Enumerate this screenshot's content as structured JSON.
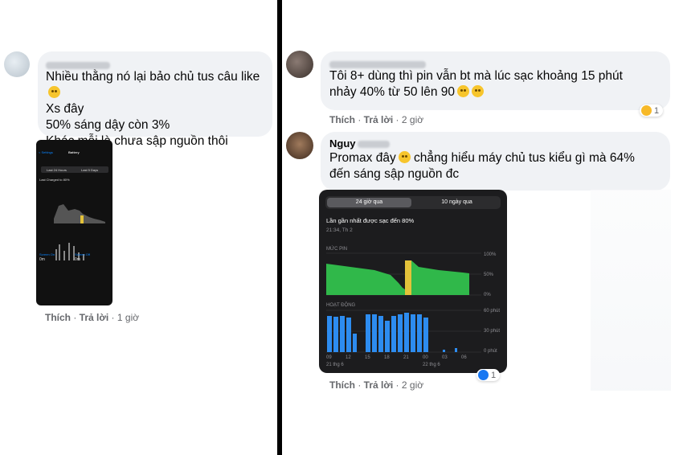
{
  "left_comment": {
    "lines": [
      "Nhiều thằng nó lại bảo chủ tus câu like",
      "Xs đây",
      "50% sáng dậy còn 3%",
      "Khác mỗi là chưa sập nguồn thôi"
    ],
    "phone_texts": {
      "back": "< Settings",
      "title": "Battery",
      "tab_a": "Last 24 Hours",
      "tab_b": "Last 5 Days",
      "last_charged": "Last Charged to 80%",
      "usage_label": "Screen On",
      "usage_value_a": "0m",
      "usage_label_b": "Screen Off",
      "usage_value_b": "0m"
    },
    "actions": {
      "like": "Thích",
      "reply": "Trả lời",
      "time": "1 giờ"
    }
  },
  "right_comment_1": {
    "lines": [
      "Tôi 8+ dùng thì pin vẫn bt mà lúc sạc khoảng 15 phút",
      "nhảy 40% từ 50 lên 90"
    ],
    "actions": {
      "like": "Thích",
      "reply": "Trả lời",
      "time": "2 giờ"
    },
    "reaction_count": "1"
  },
  "right_comment_2": {
    "name": "Nguy",
    "lines": [
      "Promax đây",
      "chẳng hiểu máy chủ tus kiểu gì mà 64%",
      "đến sáng sập nguồn đc"
    ],
    "actions": {
      "like": "Thích",
      "reply": "Trả lời",
      "time": "2 giờ"
    },
    "reaction_count": "1",
    "battery": {
      "tab_a": "24 giờ qua",
      "tab_b": "10 ngày qua",
      "last_charged": "Lần gần nhất được sạc đến 80%",
      "date": "21:34, Th 2",
      "level_title": "MỨC PIN",
      "level_ticks": [
        "100%",
        "50%",
        "0%"
      ],
      "activity_title": "HOẠT ĐỘNG",
      "activity_ticks": [
        "60 phút",
        "30 phút",
        "0 phút"
      ],
      "x_ticks": [
        "09",
        "12",
        "15",
        "18",
        "21",
        "00",
        "03",
        "06"
      ],
      "day_a": "21 thg 6",
      "day_b": "22 thg 6"
    }
  },
  "colors": {
    "bubble": "#f0f2f5",
    "battery_green": "#30b84a",
    "activity_blue": "#2d8cf0",
    "charge_yellow": "#e3c23a"
  }
}
